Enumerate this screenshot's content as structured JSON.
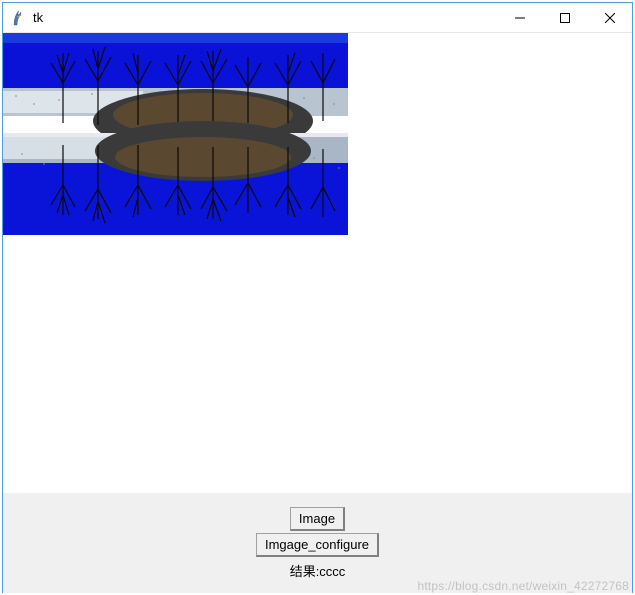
{
  "window": {
    "title": "tk"
  },
  "controls": {
    "minimize": "—",
    "maximize": "☐",
    "close": "✕"
  },
  "buttons": {
    "image": "Image",
    "image_configure": "Imgage_configure"
  },
  "result": {
    "label": "结果:cccc"
  },
  "watermark": "https://blog.csdn.net/weixin_42272768"
}
